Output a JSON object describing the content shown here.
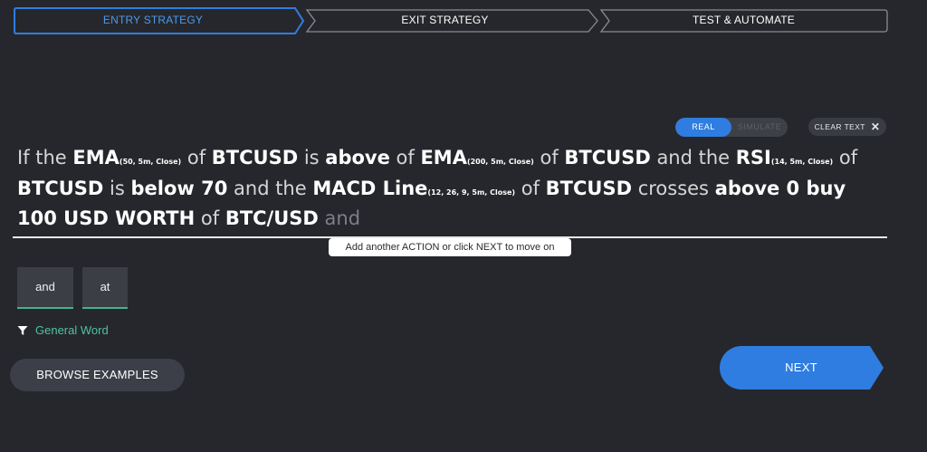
{
  "colors": {
    "background": "#26272c",
    "accent_blue": "#2f7de0",
    "active_step": "#4a9bf0",
    "green": "#3fb48f"
  },
  "steps": [
    {
      "label": "ENTRY STRATEGY",
      "active": true
    },
    {
      "label": "EXIT STRATEGY",
      "active": false
    },
    {
      "label": "TEST & AUTOMATE",
      "active": false
    }
  ],
  "mode_toggle": {
    "real": "REAL",
    "simulate": "SIMULATE",
    "selected": "REAL"
  },
  "clear_text": {
    "label": "CLEAR TEXT",
    "icon": "close-icon"
  },
  "sentence": {
    "t1": "If the ",
    "ema1": "EMA",
    "ema1_params": "(50, 5m, Close)",
    "t2": " of ",
    "sym1": "BTCUSD",
    "t3": " is ",
    "cond1": "above",
    "t4": " of ",
    "ema2": "EMA",
    "ema2_params": "(200, 5m, Close)",
    "t5": " of ",
    "sym2": "BTCUSD",
    "t6": " and the ",
    "rsi": "RSI",
    "rsi_params": "(14, 5m, Close)",
    "t7": " of ",
    "sym3": "BTCUSD",
    "t8": " is ",
    "cond2": "below 70",
    "t9": " and the ",
    "macd": "MACD Line",
    "macd_params": "(12, 26, 9, 5m, Close)",
    "t10": " of ",
    "sym4": "BTCUSD",
    "t11": " crosses ",
    "cond3": "above 0 buy",
    "amount": "100 USD WORTH",
    "t12": " of ",
    "pair": "BTC/USD",
    "ghost": " and"
  },
  "hint": "Add another ACTION or click NEXT to move on",
  "suggestions": [
    "and",
    "at"
  ],
  "filter": {
    "icon": "filter-icon",
    "label": "General Word"
  },
  "browse_examples": "BROWSE EXAMPLES",
  "next": "NEXT"
}
